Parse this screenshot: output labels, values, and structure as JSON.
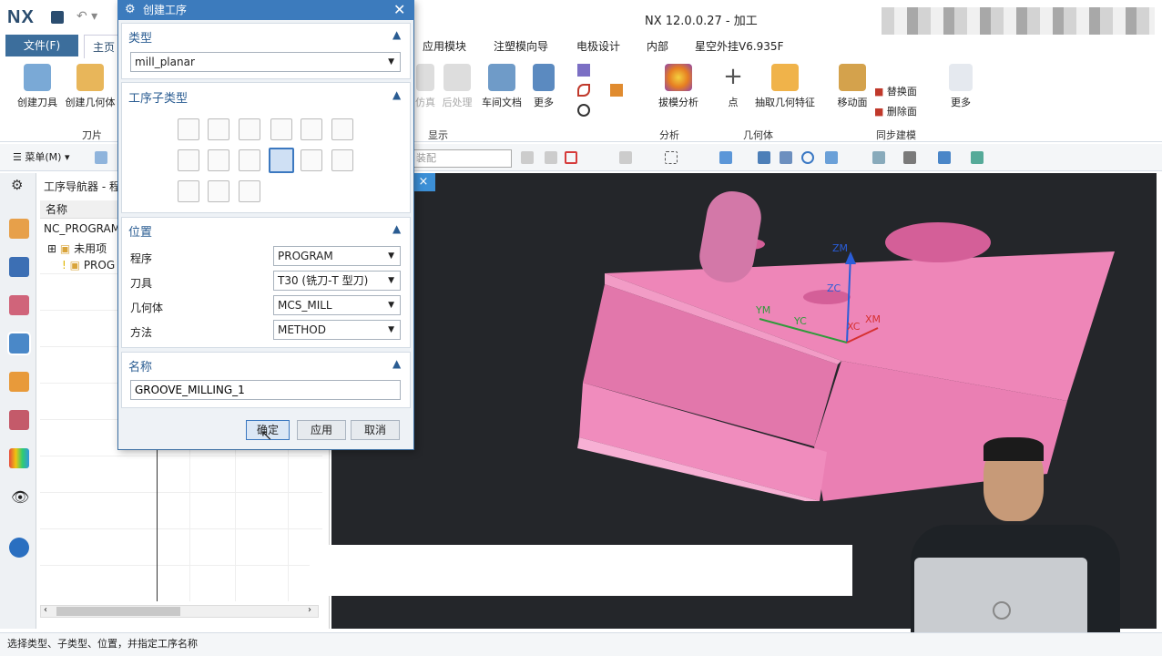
{
  "app": {
    "logo": "NX",
    "title": "NX 12.0.0.27 - 加工"
  },
  "ribbon": {
    "tabs": [
      {
        "label": "文件(F)"
      },
      {
        "label": "主页"
      },
      {
        "label": "应用模块"
      },
      {
        "label": "注塑模向导"
      },
      {
        "label": "电极设计"
      },
      {
        "label": "内部"
      },
      {
        "label": "星空外挂V6.935F"
      }
    ],
    "buttons": {
      "create_tool": "创建刀具",
      "create_geometry": "创建几何体",
      "simulate": "仿真",
      "post": "后处理",
      "shop_doc": "车间文档",
      "more1": "更多",
      "draft_analysis": "拔模分析",
      "point": "点",
      "extract": "抽取几何特征",
      "move_face": "移动面",
      "replace_face": "替换面",
      "delete_face": "删除面",
      "more2": "更多"
    },
    "groups": {
      "blade": "刀片",
      "display": "显示",
      "analysis": "分析",
      "geometry": "几何体",
      "sync": "同步建模"
    }
  },
  "toolbar": {
    "menu": "菜单(M)",
    "select_combo": "装配"
  },
  "navigator": {
    "title": "工序导航器 - 程",
    "column": "名称",
    "rows": [
      "NC_PROGRAM",
      "未用项",
      "PROG"
    ]
  },
  "viewport": {
    "tab_close": "×",
    "axes": {
      "zm": "ZM",
      "zc": "ZC",
      "ym": "YM",
      "yc": "YC",
      "xc": "XC",
      "xm": "XM"
    }
  },
  "status": "选择类型、子类型、位置，并指定工序名称",
  "dialog": {
    "title": "创建工序",
    "type_section": "类型",
    "type_value": "mill_planar",
    "subtype_section": "工序子类型",
    "location_section": "位置",
    "fields": [
      {
        "label": "程序",
        "value": "PROGRAM"
      },
      {
        "label": "刀具",
        "value": "T30 (铣刀-T 型刀)"
      },
      {
        "label": "几何体",
        "value": "MCS_MILL"
      },
      {
        "label": "方法",
        "value": "METHOD"
      }
    ],
    "name_section": "名称",
    "name_value": "GROOVE_MILLING_1",
    "ok": "确定",
    "apply": "应用",
    "cancel": "取消"
  }
}
